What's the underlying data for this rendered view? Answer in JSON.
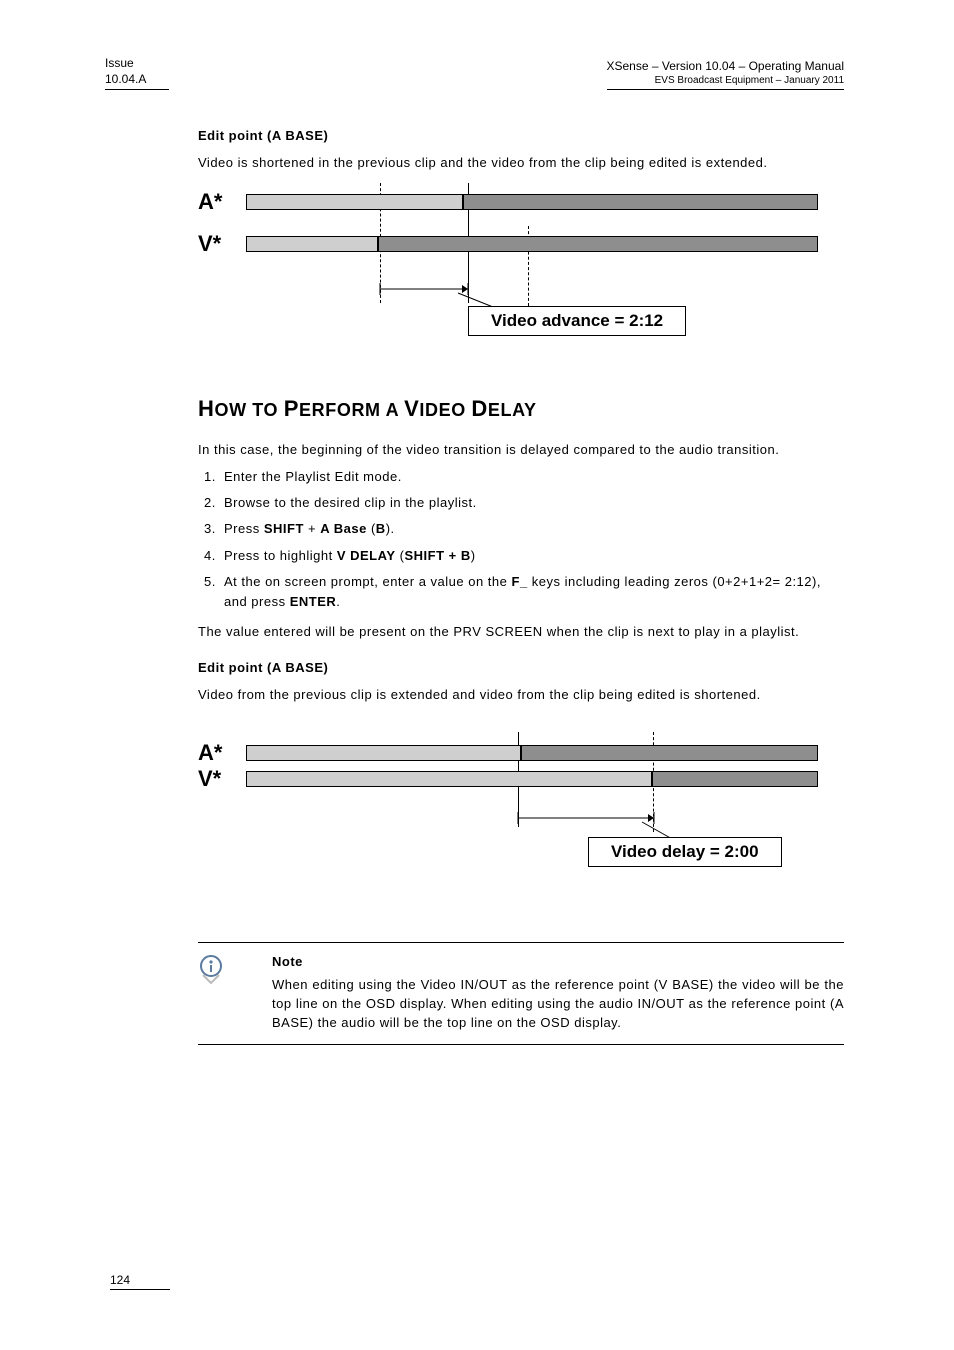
{
  "header": {
    "issue_line1": "Issue",
    "issue_line2": "10.04.A",
    "right_title": "XSense – Version 10.04 – Operating Manual",
    "right_sub": "EVS Broadcast Equipment  – January 2011"
  },
  "section1": {
    "heading": "Edit point (A BASE)",
    "text": "Video is shortened in the previous clip and the video from the clip being edited is extended."
  },
  "diagram1": {
    "a_label": "A*",
    "v_label": "V*",
    "callout": "Video advance = 2:12"
  },
  "section2_title_parts": {
    "p1a": "H",
    "p1b": "OW TO ",
    "p2a": "P",
    "p2b": "ERFORM A ",
    "p3a": "V",
    "p3b": "IDEO ",
    "p4a": "D",
    "p4b": "ELAY"
  },
  "section2_intro": "In this case, the beginning of the video transition is delayed compared to the audio transition.",
  "steps": {
    "s1": "Enter the Playlist Edit mode.",
    "s2": "Browse to the desired clip in the playlist.",
    "s3_pre": "Press ",
    "s3_b1": "SHIFT",
    "s3_mid": " + ",
    "s3_b2": "A Base",
    "s3_post1": " (",
    "s3_b3": "B",
    "s3_post2": ").",
    "s4_pre": "Press to highlight ",
    "s4_b1": "V DELAY",
    "s4_post1": " (",
    "s4_b2": "SHIFT + B",
    "s4_post2": ")",
    "s5_pre": "At the on screen prompt, enter a value on the ",
    "s5_b1": "F_",
    "s5_mid": " keys including leading zeros (0+2+1+2= 2:12), and press ",
    "s5_b2": "ENTER",
    "s5_post": "."
  },
  "section2_after": "The value entered will be present on the PRV SCREEN when the clip is next to play in a playlist.",
  "section3": {
    "heading": "Edit point (A BASE)",
    "text": "Video from the previous clip is extended and video from the clip being edited is shortened."
  },
  "diagram2": {
    "a_label": "A*",
    "v_label": "V*",
    "callout": "Video delay = 2:00"
  },
  "note": {
    "label": "Note",
    "text": "When editing using the Video IN/OUT as the reference point (V BASE) the video will be the top line on the OSD display. When editing using the audio IN/OUT as the reference point (A BASE) the audio will be the top line on the OSD display."
  },
  "page_number": "124"
}
